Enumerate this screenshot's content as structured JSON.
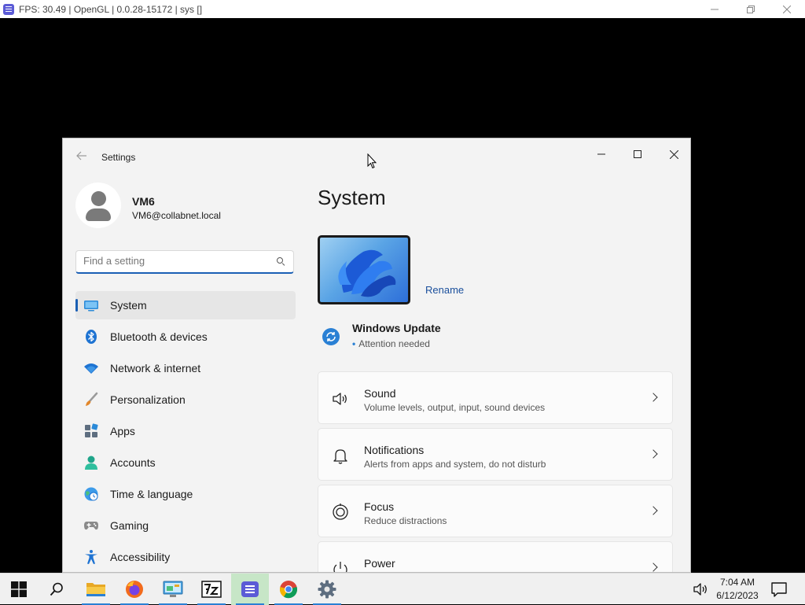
{
  "host": {
    "title": "FPS: 30.49 | OpenGL | 0.0.28-15172 | sys []",
    "controls": [
      "minimize-icon",
      "restore-icon",
      "close-icon"
    ]
  },
  "window": {
    "title": "Settings",
    "controls": [
      "minimize-icon",
      "maximize-icon",
      "close-icon"
    ]
  },
  "profile": {
    "name": "VM6",
    "email": "VM6@collabnet.local"
  },
  "search": {
    "placeholder": "Find a setting"
  },
  "nav": {
    "items": [
      {
        "label": "System",
        "icon": "system-icon",
        "active": true
      },
      {
        "label": "Bluetooth & devices",
        "icon": "bluetooth-icon"
      },
      {
        "label": "Network & internet",
        "icon": "wifi-icon"
      },
      {
        "label": "Personalization",
        "icon": "brush-icon"
      },
      {
        "label": "Apps",
        "icon": "apps-icon"
      },
      {
        "label": "Accounts",
        "icon": "accounts-icon"
      },
      {
        "label": "Time & language",
        "icon": "globe-clock-icon"
      },
      {
        "label": "Gaming",
        "icon": "gamepad-icon"
      },
      {
        "label": "Accessibility",
        "icon": "accessibility-icon"
      }
    ]
  },
  "main": {
    "title": "System",
    "rename_label": "Rename",
    "windows_update": {
      "title": "Windows Update",
      "status": "Attention needed"
    },
    "cards": [
      {
        "title": "Sound",
        "subtitle": "Volume levels, output, input, sound devices",
        "icon": "speaker-icon"
      },
      {
        "title": "Notifications",
        "subtitle": "Alerts from apps and system, do not disturb",
        "icon": "bell-icon"
      },
      {
        "title": "Focus",
        "subtitle": "Reduce distractions",
        "icon": "focus-icon"
      },
      {
        "title": "Power",
        "subtitle": "",
        "icon": "power-icon"
      }
    ]
  },
  "taskbar": {
    "apps": [
      "start-icon",
      "search-icon",
      "file-explorer-icon",
      "firefox-icon",
      "control-panel-icon",
      "7zip-icon",
      "app-window-icon",
      "chrome-icon",
      "settings-gear-icon"
    ],
    "time": "7:04 AM",
    "date": "6/12/2023"
  },
  "colors": {
    "accent": "#1a5fb4",
    "link": "#1a4f9c",
    "window_bg": "#f3f3f3",
    "card_bg": "#fbfbfb"
  }
}
